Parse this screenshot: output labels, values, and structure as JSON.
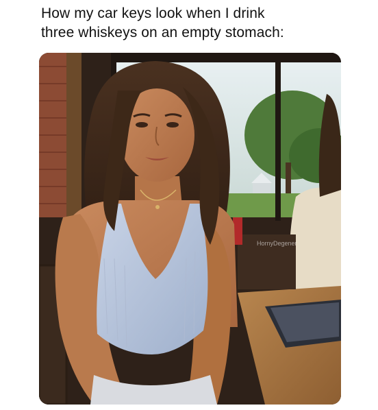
{
  "caption": {
    "line1": "How my car keys look when I drink",
    "line2": "three whiskeys on an empty stomach:"
  },
  "photo": {
    "watermark": "HornyDegener"
  }
}
